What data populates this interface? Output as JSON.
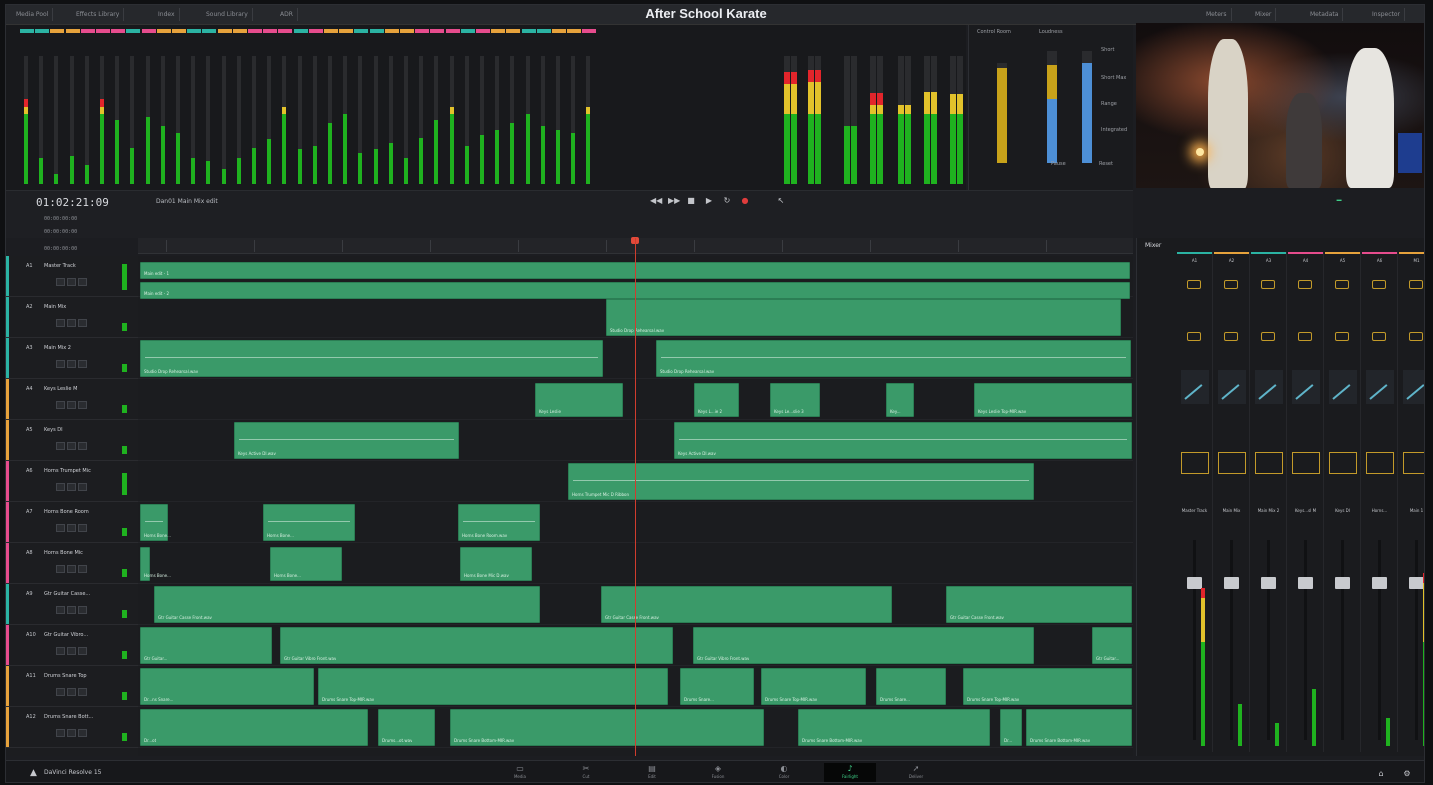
{
  "app": {
    "project_title": "After School Karate",
    "brand": "DaVinci Resolve 15"
  },
  "topbar": {
    "left_buttons": [
      "Media Pool",
      "Effects Library",
      "Index",
      "Sound Library",
      "ADR"
    ],
    "right_buttons": [
      "Meters",
      "Mixer",
      "Metadata",
      "Inspector"
    ]
  },
  "meters": {
    "control_room_label": "Control Room",
    "loudness_label": "Loudness",
    "loudness_fields": [
      "Short",
      "Short Max",
      "Range",
      "Integrated"
    ],
    "loudness_footer": [
      "Pause",
      "Reset"
    ]
  },
  "transport": {
    "timecode": "01:02:21:09",
    "timeline_name": "Dan01 Main Mix edit",
    "sub_timecodes": [
      "00:00:00:00",
      "00:00:00:00",
      "00:00:00:00"
    ],
    "buttons": [
      "rewind",
      "fast-forward",
      "stop",
      "play",
      "loop",
      "record"
    ]
  },
  "tracks": [
    {
      "id": "A1",
      "name": "Master Track",
      "color": "#2bb3a3",
      "clips": [
        {
          "label": "Main edit - 1",
          "wave": false
        },
        {
          "label": "Main edit - 2",
          "wave": false
        }
      ]
    },
    {
      "id": "A2",
      "name": "Main Mix",
      "color": "#2bb3a3",
      "clips": [
        {
          "label": "Studio Drop Rehearsal.wav",
          "wave": false
        }
      ]
    },
    {
      "id": "A3",
      "name": "Main Mix 2",
      "color": "#2bb3a3",
      "clips": [
        {
          "label": "Studio Drop Rehearsal.wav",
          "wave": true
        },
        {
          "label": "Studio Drop Rehearsal.wav",
          "wave": true
        }
      ]
    },
    {
      "id": "A4",
      "name": "Keys Leslie M",
      "color": "#e6a23c",
      "clips": [
        {
          "label": "Keys Leslie",
          "wave": false
        },
        {
          "label": "Keys L...ie 2",
          "wave": false
        },
        {
          "label": "Keys Le...slie 3",
          "wave": false
        },
        {
          "label": "Key...",
          "wave": false
        },
        {
          "label": "Keys Leslie Top-MIR.wav",
          "wave": false
        }
      ]
    },
    {
      "id": "A5",
      "name": "Keys DI",
      "color": "#e6a23c",
      "clips": [
        {
          "label": "Keys Active DI.wav",
          "wave": true
        },
        {
          "label": "Keys Active DI.wav",
          "wave": true
        }
      ]
    },
    {
      "id": "A6",
      "name": "Horns Trumpet Mic",
      "color": "#e64c8d",
      "clips": [
        {
          "label": "Horns Trumpet Mic D Ribbon",
          "wave": true
        }
      ]
    },
    {
      "id": "A7",
      "name": "Horns Bone Room",
      "color": "#e64c8d",
      "clips": [
        {
          "label": "Horns Bone...",
          "wave": true
        },
        {
          "label": "Horns Bone...",
          "wave": true
        },
        {
          "label": "Horns Bone Room.wav",
          "wave": true
        }
      ]
    },
    {
      "id": "A8",
      "name": "Horns Bone Mic",
      "color": "#e64c8d",
      "clips": [
        {
          "label": "Horns Bone...",
          "wave": false
        },
        {
          "label": "Horns Bone...",
          "wave": false
        },
        {
          "label": "Horns Bone Mic D.wav",
          "wave": false
        }
      ]
    },
    {
      "id": "A9",
      "name": "Gtr Guitar Casse...",
      "color": "#2bb3a3",
      "clips": [
        {
          "label": "Gtr Guitar Casse Front.wav",
          "wave": false
        },
        {
          "label": "Gtr Guitar Casse Front.wav",
          "wave": false
        },
        {
          "label": "Gtr Guitar Casse Front.wav",
          "wave": false
        },
        {
          "label": "Gtr Guitar Casse Front.wav",
          "wave": false
        }
      ]
    },
    {
      "id": "A10",
      "name": "Gtr Guitar Vibro...",
      "color": "#e64c8d",
      "clips": [
        {
          "label": "Gtr Guitar...",
          "wave": false
        },
        {
          "label": "Gtr Guitar Vibro Front.wav",
          "wave": false
        },
        {
          "label": "Gtr Guitar Vibro Front.wav",
          "wave": false
        },
        {
          "label": "Gtr Guitar...",
          "wave": false
        }
      ]
    },
    {
      "id": "A11",
      "name": "Drums Snare Top",
      "color": "#e6a23c",
      "clips": [
        {
          "label": "Dr...ns Snare...",
          "wave": false
        },
        {
          "label": "Drums Snare Top-MIR.wav",
          "wave": false
        },
        {
          "label": "Drums Snare...",
          "wave": false
        },
        {
          "label": "Drums Snare Top-MIR.wav",
          "wave": false
        },
        {
          "label": "Drums Snare...",
          "wave": false
        },
        {
          "label": "Drums Snare Top-MIR.wav",
          "wave": false
        }
      ]
    },
    {
      "id": "A12",
      "name": "Drums Snare Bott...",
      "color": "#e6a23c",
      "clips": [
        {
          "label": "Dr...ot",
          "wave": false
        },
        {
          "label": "Drums...ot.wav",
          "wave": false
        },
        {
          "label": "Drums Snare Bottom-MIR.wav",
          "wave": false
        },
        {
          "label": "Drums Snare Bottom-MIR.wav",
          "wave": false
        },
        {
          "label": "Dr...",
          "wave": false
        },
        {
          "label": "Drums Snare Bottom-MIR.wav",
          "wave": false
        }
      ]
    }
  ],
  "mixer": {
    "title": "Mixer",
    "channels": [
      {
        "id": "A1",
        "name": "Master Track",
        "color": "#2bb3a3"
      },
      {
        "id": "A2",
        "name": "Main Mix",
        "color": "#e6a23c"
      },
      {
        "id": "A3",
        "name": "Main Mix 2",
        "color": "#2bb3a3"
      },
      {
        "id": "A4",
        "name": "Keys...sl M",
        "color": "#e64c8d"
      },
      {
        "id": "A5",
        "name": "Keys DI",
        "color": "#e6a23c"
      },
      {
        "id": "A6",
        "name": "Horns...",
        "color": "#e64c8d"
      },
      {
        "id": "M1",
        "name": "Main 1",
        "color": "#e6a23c"
      }
    ]
  },
  "pages": [
    {
      "label": "Media",
      "icon": "media-icon",
      "active": false
    },
    {
      "label": "Cut",
      "icon": "cut-icon",
      "active": false
    },
    {
      "label": "Edit",
      "icon": "edit-icon",
      "active": false
    },
    {
      "label": "Fusion",
      "icon": "fusion-icon",
      "active": false
    },
    {
      "label": "Color",
      "icon": "color-icon",
      "active": false
    },
    {
      "label": "Fairlight",
      "icon": "fairlight-icon",
      "active": true
    },
    {
      "label": "Deliver",
      "icon": "deliver-icon",
      "active": false
    }
  ],
  "colors": {
    "accent_active": "#3fd38a",
    "clip_green": "#3a9a69",
    "playhead": "#d03c2e",
    "meter_green": "#1fb21f",
    "meter_amber": "#e2c22b",
    "meter_red": "#e2252b"
  }
}
